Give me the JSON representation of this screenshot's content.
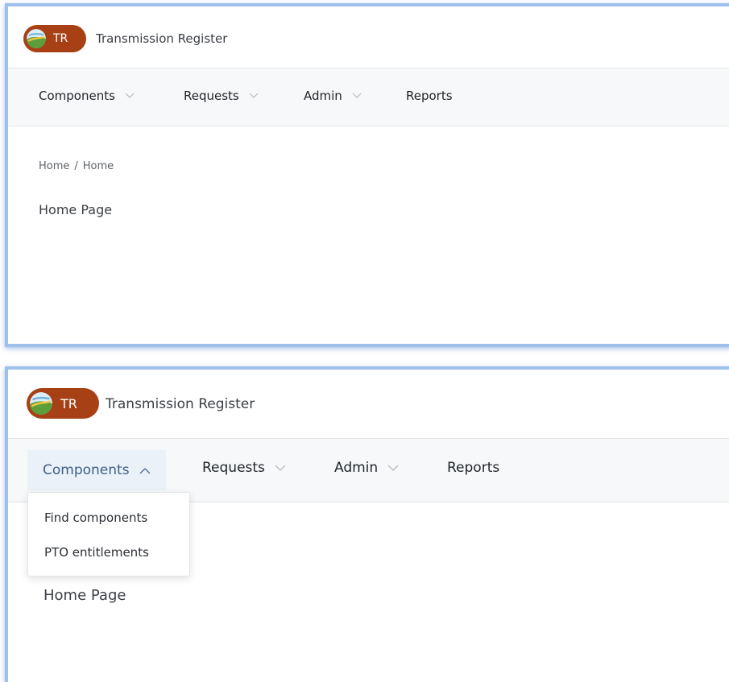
{
  "app": {
    "logo_text": "TR",
    "title": "Transmission Register"
  },
  "nav": {
    "items": [
      {
        "label": "Components",
        "has_dropdown": true
      },
      {
        "label": "Requests",
        "has_dropdown": true
      },
      {
        "label": "Admin",
        "has_dropdown": true
      },
      {
        "label": "Reports",
        "has_dropdown": false
      }
    ]
  },
  "breadcrumb": [
    "Home",
    "Home"
  ],
  "breadcrumb_separator": "/",
  "page_title": "Home Page",
  "components_menu": {
    "items": [
      "Find components",
      "PTO entitlements"
    ]
  },
  "colors": {
    "logo_pill": "#a84016",
    "nav_bar": "#f7f8f9",
    "active_nav_bg": "#eaf1f8",
    "active_nav_text": "#3f5f86",
    "frame_border": "#9fc0ea"
  },
  "icons": {
    "logo": "globe-logo-icon",
    "dropdown_closed": "chevron-down-icon",
    "dropdown_open": "chevron-up-icon"
  }
}
